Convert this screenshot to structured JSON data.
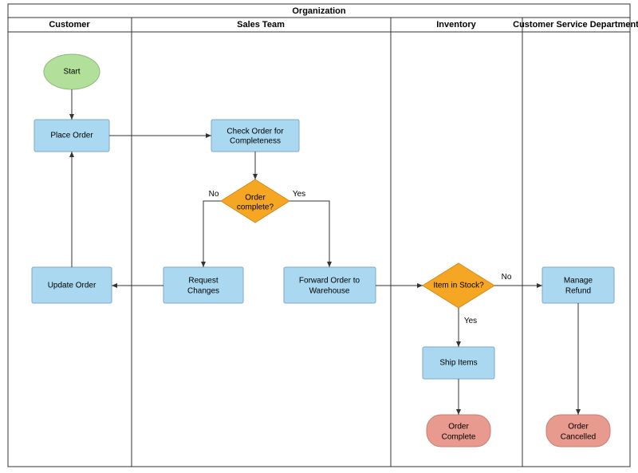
{
  "pool": {
    "title": "Organization"
  },
  "lanes": [
    {
      "title": "Customer"
    },
    {
      "title": "Sales Team"
    },
    {
      "title": "Inventory"
    },
    {
      "title": "Customer Service Department"
    }
  ],
  "nodes": {
    "start": "Start",
    "place_order": "Place Order",
    "check_order": "Check Order for Completeness",
    "order_complete_q": "Order complete?",
    "request_changes": "Request Changes",
    "update_order": "Update Order",
    "forward_order": "Forward Order to Warehouse",
    "item_in_stock_q": "Item in Stock?",
    "ship_items": "Ship Items",
    "order_complete_end": "Order Complete",
    "manage_refund": "Manage Refund",
    "order_cancelled_end": "Order Cancelled"
  },
  "labels": {
    "no": "No",
    "yes": "Yes"
  },
  "chart_data": {
    "type": "swimlane-flowchart",
    "pool": "Organization",
    "lanes": [
      "Customer",
      "Sales Team",
      "Inventory",
      "Customer Service Department"
    ],
    "nodes": [
      {
        "id": "start",
        "lane": "Customer",
        "type": "start",
        "label": "Start"
      },
      {
        "id": "place_order",
        "lane": "Customer",
        "type": "process",
        "label": "Place Order"
      },
      {
        "id": "check_order",
        "lane": "Sales Team",
        "type": "process",
        "label": "Check Order for Completeness"
      },
      {
        "id": "order_complete_q",
        "lane": "Sales Team",
        "type": "decision",
        "label": "Order complete?"
      },
      {
        "id": "request_changes",
        "lane": "Sales Team",
        "type": "process",
        "label": "Request Changes"
      },
      {
        "id": "update_order",
        "lane": "Customer",
        "type": "process",
        "label": "Update Order"
      },
      {
        "id": "forward_order",
        "lane": "Sales Team",
        "type": "process",
        "label": "Forward Order to Warehouse"
      },
      {
        "id": "item_in_stock_q",
        "lane": "Inventory",
        "type": "decision",
        "label": "Item in Stock?"
      },
      {
        "id": "ship_items",
        "lane": "Inventory",
        "type": "process",
        "label": "Ship Items"
      },
      {
        "id": "order_complete_end",
        "lane": "Inventory",
        "type": "terminator",
        "label": "Order Complete"
      },
      {
        "id": "manage_refund",
        "lane": "Customer Service Department",
        "type": "process",
        "label": "Manage Refund"
      },
      {
        "id": "order_cancelled_end",
        "lane": "Customer Service Department",
        "type": "terminator",
        "label": "Order Cancelled"
      }
    ],
    "edges": [
      {
        "from": "start",
        "to": "place_order"
      },
      {
        "from": "place_order",
        "to": "check_order"
      },
      {
        "from": "check_order",
        "to": "order_complete_q"
      },
      {
        "from": "order_complete_q",
        "to": "request_changes",
        "label": "No"
      },
      {
        "from": "order_complete_q",
        "to": "forward_order",
        "label": "Yes"
      },
      {
        "from": "request_changes",
        "to": "update_order"
      },
      {
        "from": "update_order",
        "to": "place_order"
      },
      {
        "from": "forward_order",
        "to": "item_in_stock_q"
      },
      {
        "from": "item_in_stock_q",
        "to": "ship_items",
        "label": "Yes"
      },
      {
        "from": "item_in_stock_q",
        "to": "manage_refund",
        "label": "No"
      },
      {
        "from": "ship_items",
        "to": "order_complete_end"
      },
      {
        "from": "manage_refund",
        "to": "order_cancelled_end"
      }
    ]
  }
}
